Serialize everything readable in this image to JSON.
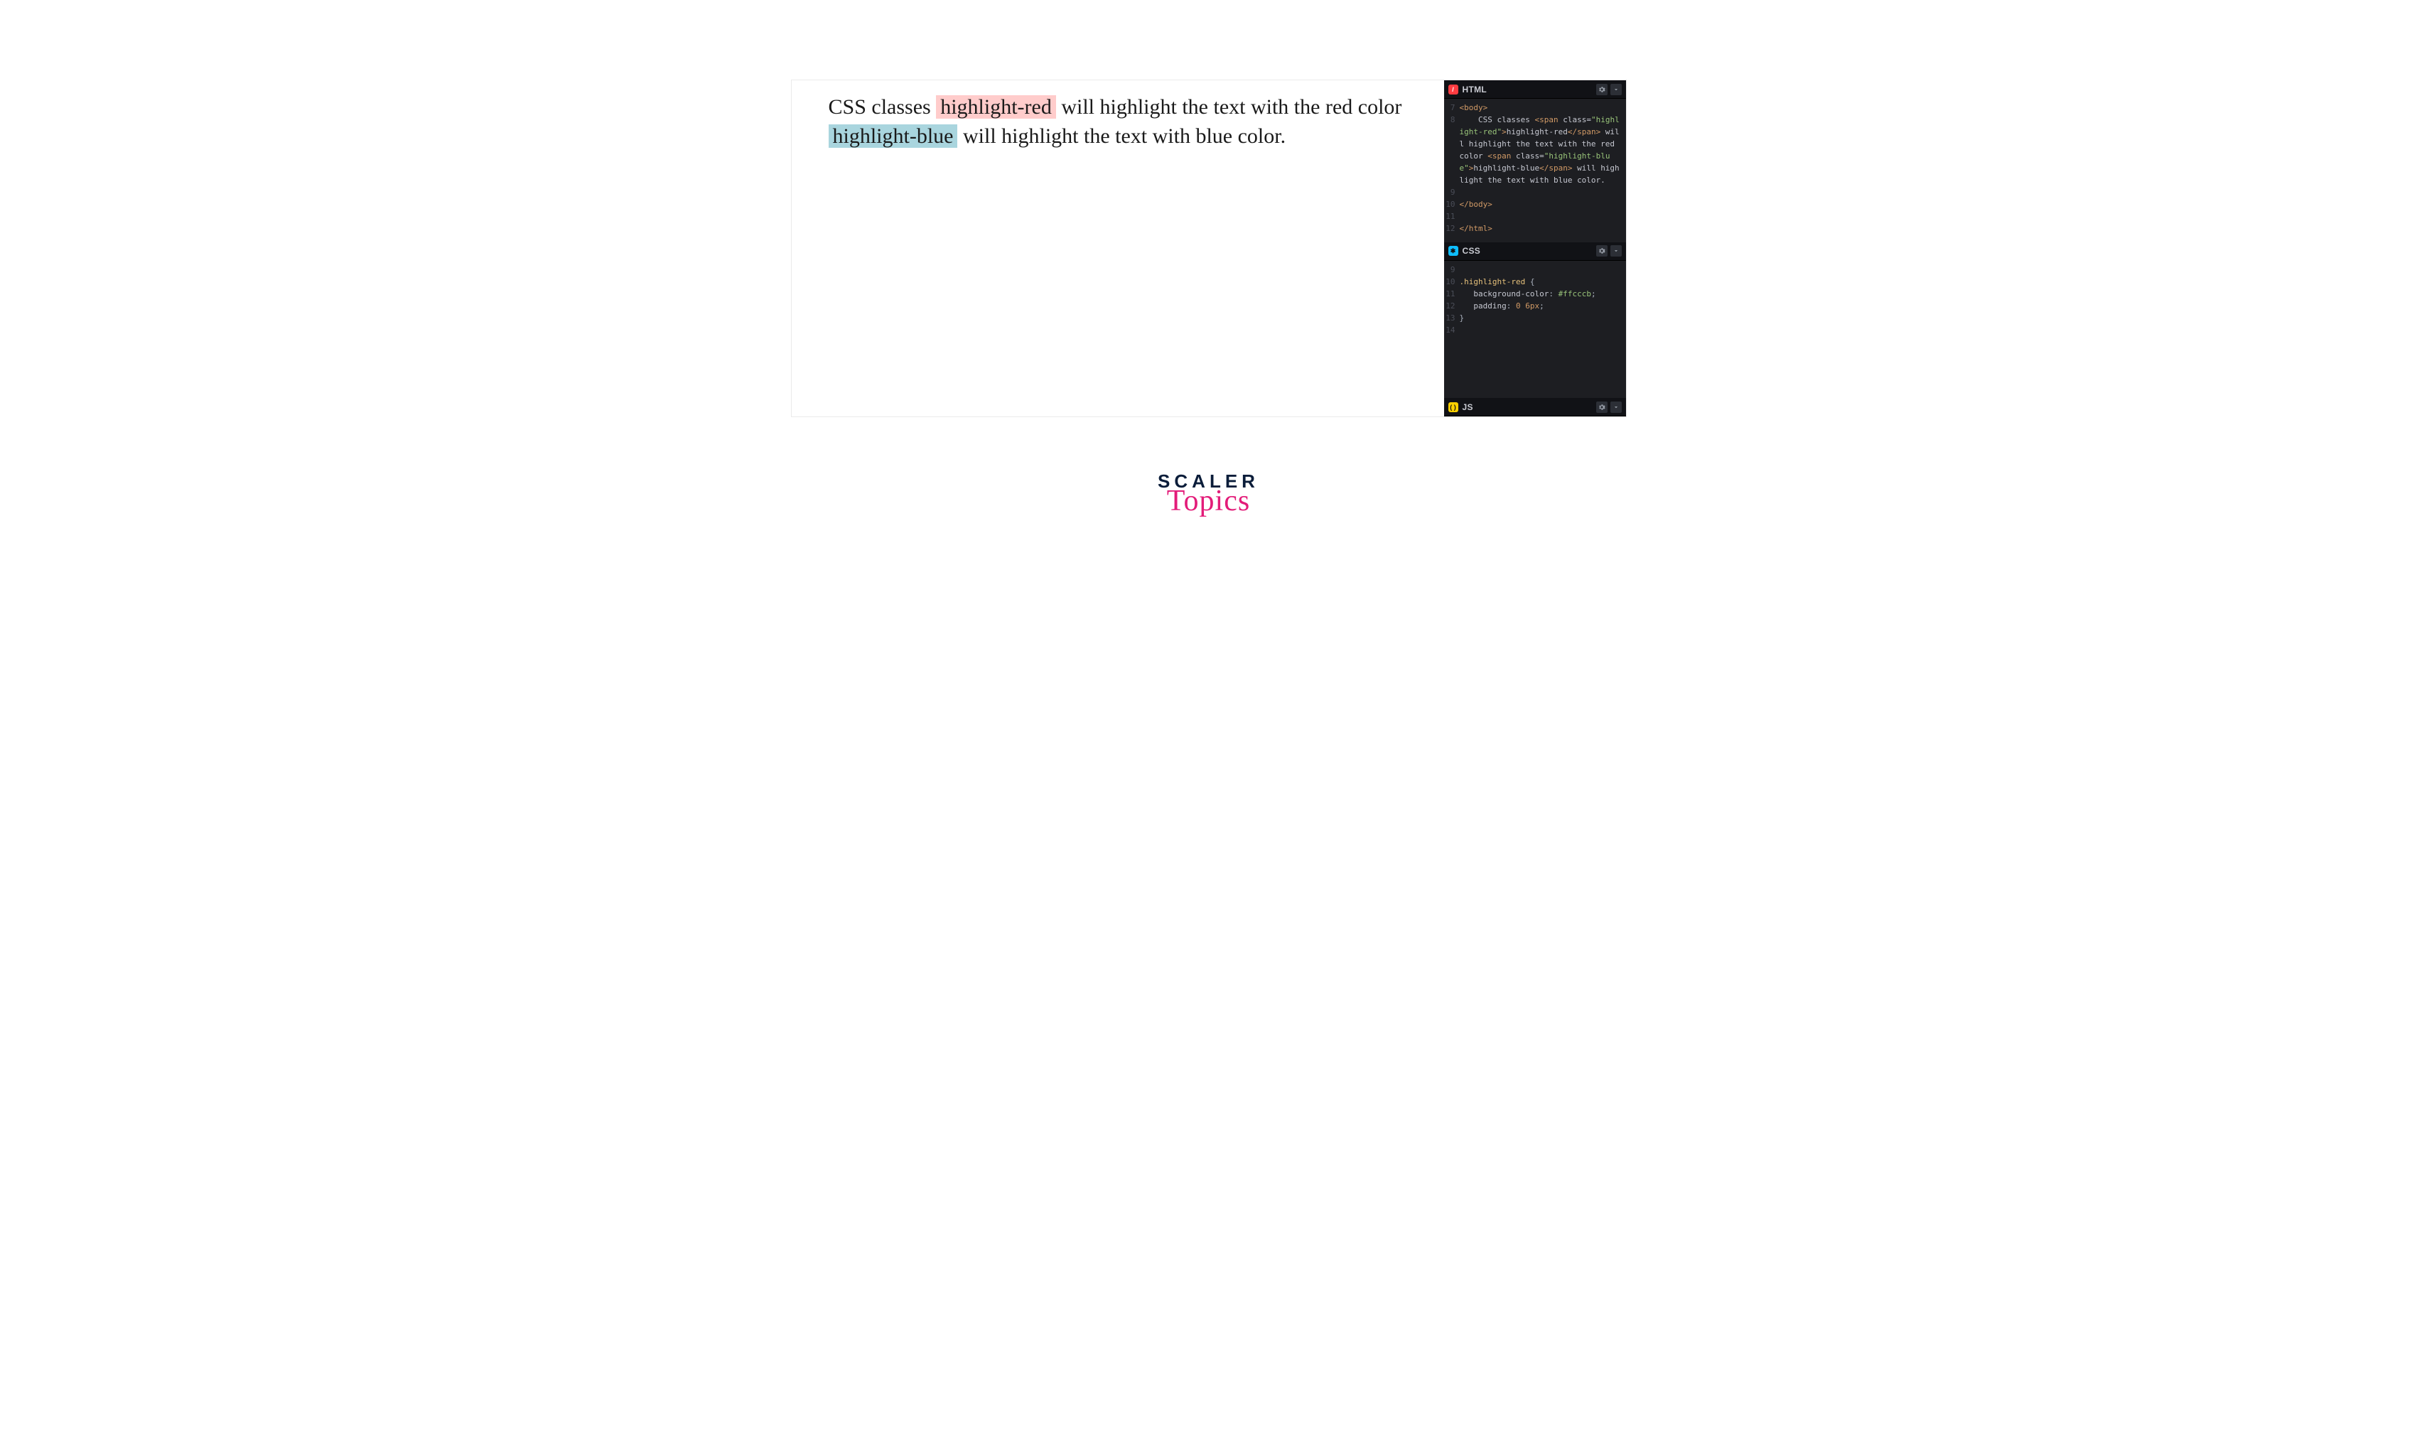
{
  "preview": {
    "seg1": "CSS classes ",
    "hl_red": "highlight-red",
    "seg2": " will highlight the text with the red color ",
    "hl_blue": "highlight-blue",
    "seg3": " will highlight the text with blue color."
  },
  "panels": {
    "html": {
      "title": "HTML"
    },
    "css": {
      "title": "CSS"
    },
    "js": {
      "title": "JS"
    }
  },
  "html_code": {
    "ln7": "7",
    "l7_tag_open": "<body>",
    "ln8": "8",
    "l8_indent": "    ",
    "l8_text1": "CSS classes ",
    "l8_span_open": "<span",
    "ln8b_attr": "class=",
    "ln8b_str": "\"highlight-red\"",
    "ln8b_gt": ">",
    "ln8b_text": "highlight-red",
    "ln8b_close": "</span>",
    "ln8b_tail": " will highlight the text with the red color ",
    "ln8c_span_open": "<span",
    "ln8c_attr": "class=",
    "ln8c_str": "\"highlight-blue\"",
    "ln8c_gt": ">",
    "ln8c_text": "highlight-blue",
    "ln8c_close": "</span>",
    "ln8c_tail": " will highlight the text with blue color.",
    "ln9": "9",
    "ln10": "10",
    "l10_tag": "</body>",
    "ln11": "11",
    "ln12": "12",
    "l12_tag": "</html>"
  },
  "css_code": {
    "ln9": "9",
    "ln10": "10",
    "l10_sel": ".highlight-red",
    "l10_brace": " {",
    "ln11": "11",
    "l11_prop": "background-color",
    "l11_colon": ": ",
    "l11_val": "#ffcccb",
    "l11_semi": ";",
    "ln12": "12",
    "l12_prop": "padding",
    "l12_colon": ": ",
    "l12_v1": "0",
    "l12_sp": " ",
    "l12_v2": "6px",
    "l12_semi": ";",
    "ln13": "13",
    "l13_brace": "}",
    "ln14": "14"
  },
  "brand": {
    "line1": "SCALER",
    "line2": "Topics"
  },
  "colors": {
    "hl_red": "#ffcccb",
    "hl_blue": "#a9d5de",
    "accent": "#e31c79"
  }
}
